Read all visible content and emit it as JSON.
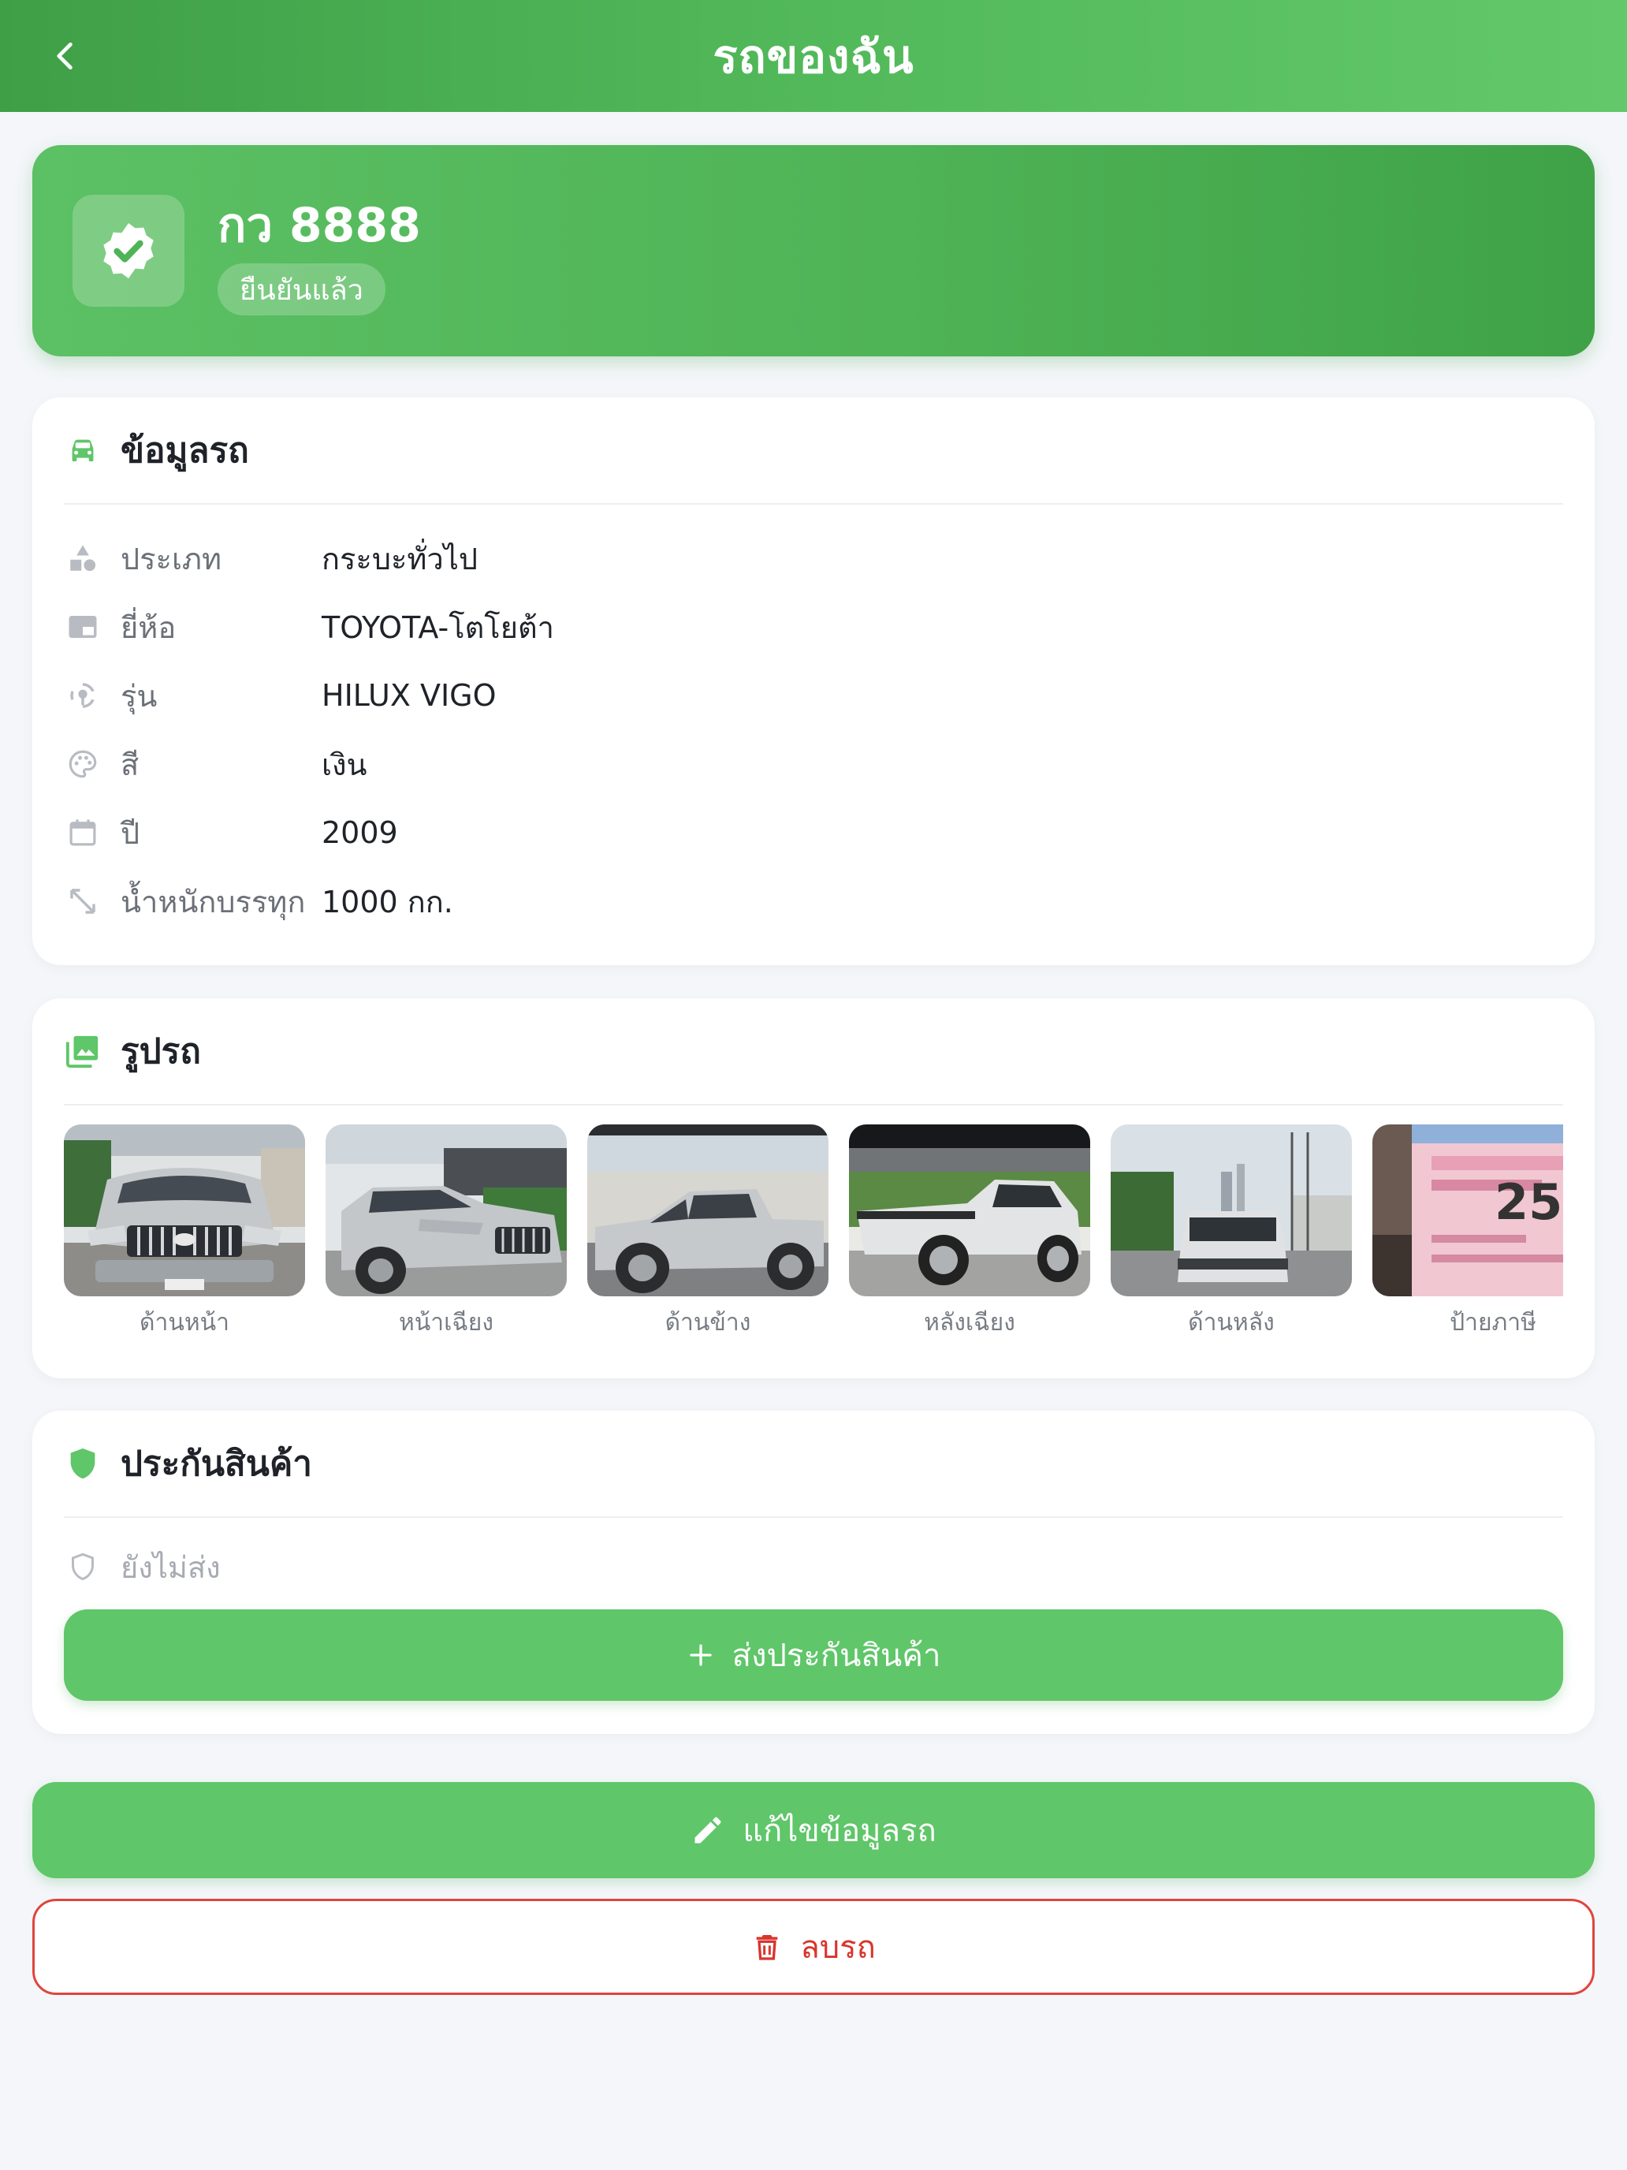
{
  "header": {
    "title": "รถของฉัน",
    "back_icon": "chevron-left-icon"
  },
  "vehicle": {
    "plate": "กว 8888",
    "status": "ยืนยันแล้ว",
    "status_icon": "verified-badge-icon"
  },
  "info_card": {
    "title": "ข้อมูลรถ",
    "rows": [
      {
        "icon": "category-icon",
        "label": "ประเภท",
        "value": "กระบะทั่วไป"
      },
      {
        "icon": "brand-icon",
        "label": "ยี่ห้อ",
        "value": "TOYOTA-โตโยต้า"
      },
      {
        "icon": "model-icon",
        "label": "รุ่น",
        "value": "HILUX VIGO"
      },
      {
        "icon": "palette-icon",
        "label": "สี",
        "value": "เงิน"
      },
      {
        "icon": "calendar-icon",
        "label": "ปี",
        "value": "2009"
      },
      {
        "icon": "weight-icon",
        "label": "น้ำหนักบรรทุก",
        "value": "1000 กก."
      }
    ]
  },
  "photos_card": {
    "title": "รูปรถ",
    "photos": [
      {
        "caption": "ด้านหน้า"
      },
      {
        "caption": "หน้าเฉียง"
      },
      {
        "caption": "ด้านข้าง"
      },
      {
        "caption": "หลังเฉียง"
      },
      {
        "caption": "ด้านหลัง"
      },
      {
        "caption": "ป้ายภาษี"
      }
    ]
  },
  "insurance_card": {
    "title": "ประกันสินค้า",
    "status": "ยังไม่ส่ง",
    "submit_label": "ส่งประกันสินค้า"
  },
  "actions": {
    "edit_label": "แก้ไขข้อมูลรถ",
    "delete_label": "ลบรถ"
  },
  "colors": {
    "primary": "#5fc669",
    "primary_dark": "#3fa247",
    "danger": "#e0453d"
  }
}
